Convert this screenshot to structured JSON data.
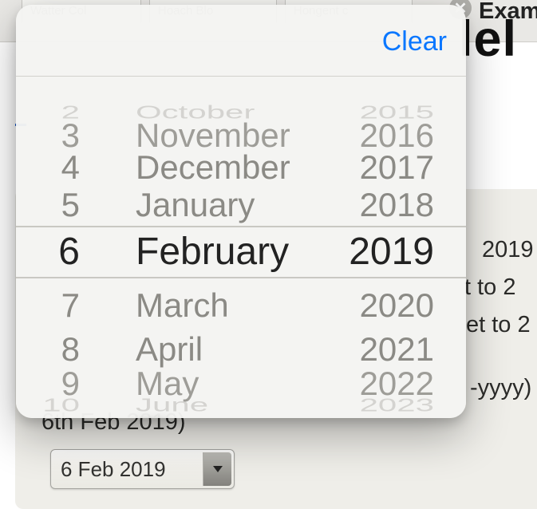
{
  "tabs": {
    "t1": "Watter Col",
    "t2": "Hoach Blo",
    "t3": "Hongent c"
  },
  "header": {
    "example": "Examp",
    "trail": "lel"
  },
  "back": {
    "r1": "2019",
    "r2": "t to 2",
    "r3": "et to 2",
    "r4": "-yyyy)",
    "r5": "6th Feb 2019)"
  },
  "select": {
    "value": "6 Feb 2019"
  },
  "popover": {
    "clear": "Clear",
    "days": {
      "n3": "2",
      "n2": "3",
      "n1": "4",
      "c0": "5",
      "sel": "6",
      "p1": "7",
      "p2": "8",
      "p3": "9",
      "p4": "10"
    },
    "months": {
      "n3": "October",
      "n2": "November",
      "n1": "December",
      "c0": "January",
      "sel": "February",
      "p1": "March",
      "p2": "April",
      "p3": "May",
      "p4": "June"
    },
    "years": {
      "n3": "2015",
      "n2": "2016",
      "n1": "2017",
      "c0": "2018",
      "sel": "2019",
      "p1": "2020",
      "p2": "2021",
      "p3": "2022",
      "p4": "2023"
    }
  }
}
